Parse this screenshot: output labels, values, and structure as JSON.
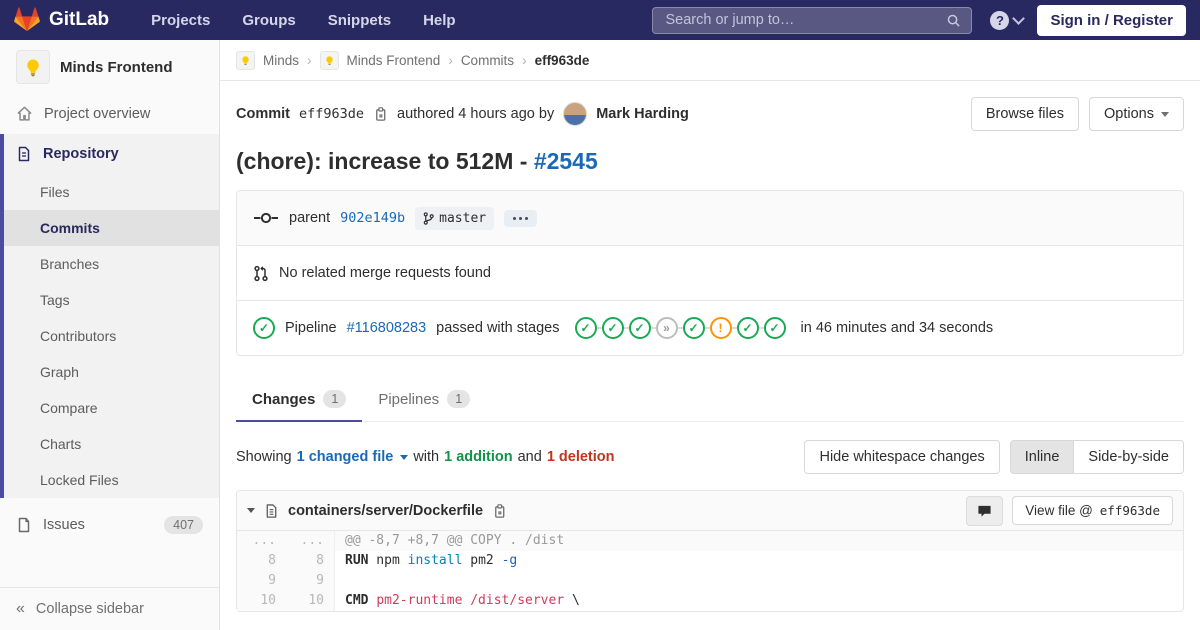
{
  "navbar": {
    "brand": "GitLab",
    "links": [
      {
        "label": "Projects"
      },
      {
        "label": "Groups"
      },
      {
        "label": "Snippets"
      },
      {
        "label": "Help"
      }
    ],
    "search_placeholder": "Search or jump to…",
    "help_glyph": "?",
    "signin_label": "Sign in / Register",
    "bg_color": "#292961"
  },
  "sidebar": {
    "project_name": "Minds Frontend",
    "overview_label": "Project overview",
    "repository_label": "Repository",
    "repo_items": [
      "Files",
      "Commits",
      "Branches",
      "Tags",
      "Contributors",
      "Graph",
      "Compare",
      "Charts",
      "Locked Files"
    ],
    "active_item": "Commits",
    "issues_label": "Issues",
    "issues_count": "407",
    "collapse_label": "Collapse sidebar",
    "collapse_glyph": "«",
    "accent_color": "#4b4ba3"
  },
  "breadcrumb": {
    "items": [
      {
        "label": "Minds",
        "avatar": true
      },
      {
        "label": "Minds Frontend",
        "avatar": true
      },
      {
        "label": "Commits",
        "avatar": false
      }
    ],
    "current": "eff963de",
    "separator": "›"
  },
  "commit": {
    "label": "Commit",
    "sha": "eff963de",
    "authored": "authored 4 hours ago by",
    "author": "Mark Harding",
    "browse_label": "Browse files",
    "options_label": "Options",
    "title": "(chore): increase to 512M -",
    "title_link": "#2545",
    "parent_label": "parent",
    "parent_sha": "902e149b",
    "branch": "master",
    "mr_text": "No related merge requests found",
    "pipeline": {
      "prefix": "Pipeline",
      "id": "#116808283",
      "middle": "passed with stages",
      "suffix": "in 46 minutes and 34 seconds",
      "overall_status": "passed",
      "stages": [
        "passed",
        "passed",
        "passed",
        "skipped",
        "passed",
        "warning",
        "passed",
        "passed"
      ],
      "stage_glyphs": {
        "passed": "✓",
        "skipped": "»",
        "warning": "!"
      },
      "passed_color": "#1aaa55",
      "warning_color": "#fc9403"
    }
  },
  "tabs": [
    {
      "label": "Changes",
      "count": "1",
      "active": true
    },
    {
      "label": "Pipelines",
      "count": "1",
      "active": false
    }
  ],
  "diff_summary": {
    "showing": "Showing",
    "changed": "1 changed file",
    "with_word": "with",
    "addition": "1 addition",
    "and_word": "and",
    "deletion": "1 deletion",
    "hide_ws": "Hide whitespace changes",
    "inline": "Inline",
    "side": "Side-by-side",
    "addition_color": "#168f48",
    "deletion_color": "#c0341d",
    "link_color": "#1b69b6"
  },
  "diff": {
    "filename": "containers/server/Dockerfile",
    "view_file": "View file @",
    "view_sha": "eff963de",
    "rows": [
      {
        "old": "...",
        "new": "...",
        "match": true,
        "segments": [
          {
            "t": "@@ -8,7 +8,7 @@ COPY . /dist",
            "c": ""
          }
        ]
      },
      {
        "old": "8",
        "new": "8",
        "match": false,
        "segments": [
          {
            "t": "RUN",
            "c": "k"
          },
          {
            "t": " npm ",
            "c": ""
          },
          {
            "t": "install",
            "c": "nb"
          },
          {
            "t": " pm2 ",
            "c": ""
          },
          {
            "t": "-g",
            "c": "opt"
          }
        ]
      },
      {
        "old": "9",
        "new": "9",
        "match": false,
        "segments": []
      },
      {
        "old": "10",
        "new": "10",
        "match": false,
        "segments": [
          {
            "t": "CMD",
            "c": "k"
          },
          {
            "t": " ",
            "c": ""
          },
          {
            "t": "pm2-runtime /dist/server",
            "c": "str"
          },
          {
            "t": " \\",
            "c": ""
          }
        ]
      }
    ]
  }
}
